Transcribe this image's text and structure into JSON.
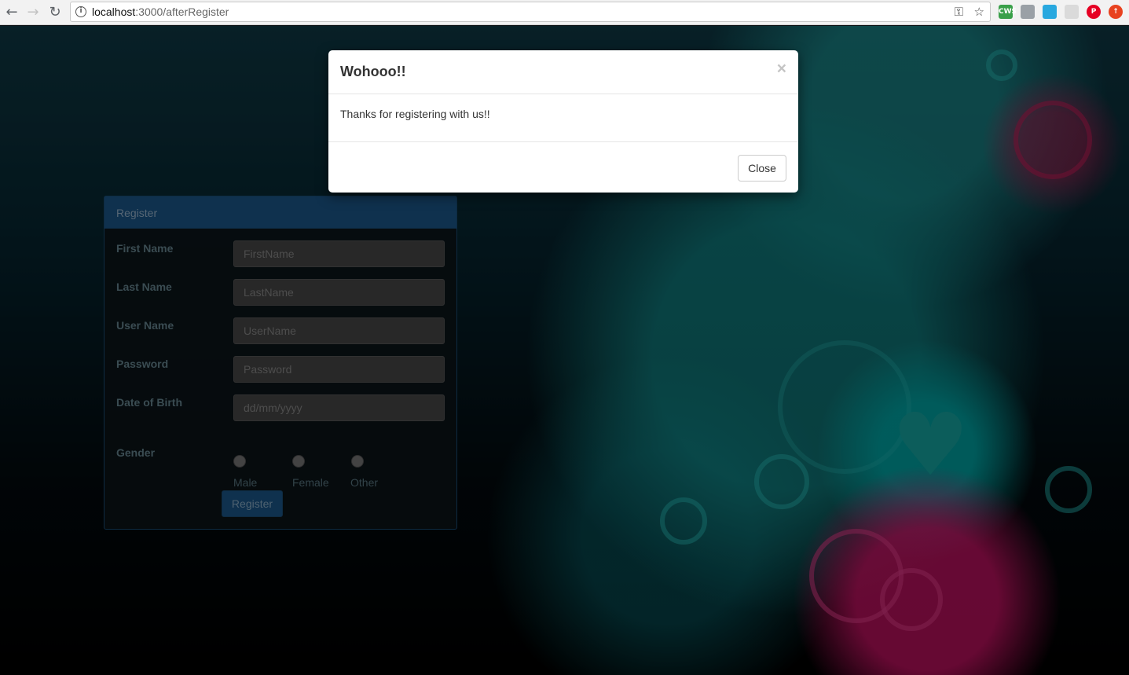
{
  "browser": {
    "url_host": "localhost",
    "url_path": ":3000/afterRegister",
    "back_icon": "←",
    "forward_icon": "→",
    "reload_icon": "↻",
    "info_icon": "i",
    "key_icon": "⚿",
    "star_icon": "☆",
    "extensions": [
      {
        "name": "cws-extension-icon",
        "text": "CWS",
        "color": "#3aa04a"
      },
      {
        "name": "image-extension-icon",
        "text": "",
        "color": "#9aa0a6"
      },
      {
        "name": "refresh-extension-icon",
        "text": "",
        "color": "#29a8df"
      },
      {
        "name": "circle-extension-icon",
        "text": "",
        "color": "#dadada"
      },
      {
        "name": "pinterest-icon",
        "text": "P",
        "color": "#e60023"
      },
      {
        "name": "upload-extension-icon",
        "text": "↑",
        "color": "#e8421f"
      }
    ]
  },
  "register": {
    "heading": "Register",
    "fields": [
      {
        "label": "First Name",
        "placeholder": "FirstName"
      },
      {
        "label": "Last Name",
        "placeholder": "LastName"
      },
      {
        "label": "User Name",
        "placeholder": "UserName"
      },
      {
        "label": "Password",
        "placeholder": "Password"
      },
      {
        "label": "Date of Birth",
        "placeholder": "dd/mm/yyyy"
      }
    ],
    "gender_label": "Gender",
    "gender_options": [
      "Male",
      "Female",
      "Other"
    ],
    "submit_label": "Register"
  },
  "modal": {
    "title": "Wohooo!!",
    "close_x": "×",
    "message": "Thanks for registering with us!!",
    "close_label": "Close"
  }
}
